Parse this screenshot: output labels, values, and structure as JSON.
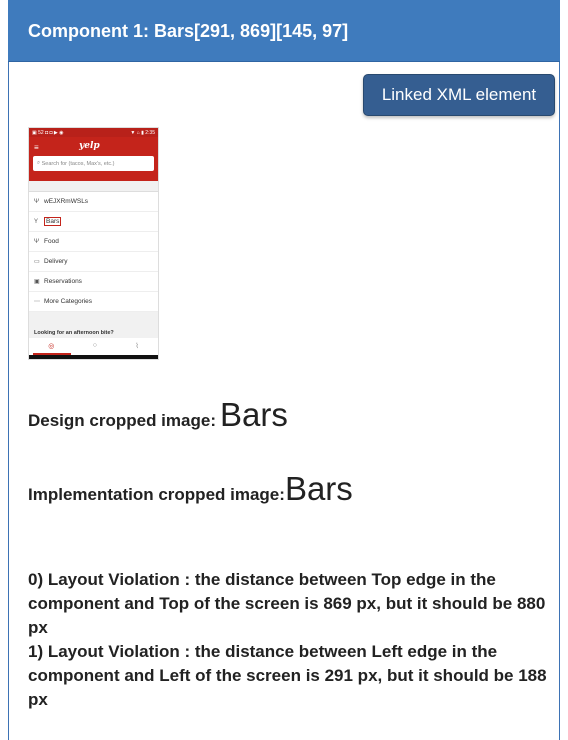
{
  "header": {
    "title": "Component 1: Bars[291, 869][145, 97]"
  },
  "button": {
    "label": "Linked XML element"
  },
  "phone": {
    "status_left": "▣ 52 ◘ ◘ ▶ ◉",
    "status_right": "▼ ⌂ ▮ 2:35",
    "logo": "yelp",
    "search_placeholder": "Search for (tacos, Max's, etc.)",
    "rows": [
      {
        "label": "wEJXRmWSLs",
        "icon": "fork-knife-icon"
      },
      {
        "label": "Bars",
        "icon": "cocktail-icon"
      },
      {
        "label": "Food",
        "icon": "fork-knife-icon"
      },
      {
        "label": "Delivery",
        "icon": "truck-icon"
      },
      {
        "label": "Reservations",
        "icon": "calendar-icon"
      },
      {
        "label": "More Categories",
        "icon": "dots-icon"
      }
    ],
    "section_title": "Looking for an afternoon bite?"
  },
  "design": {
    "label": "Design cropped image:",
    "crop_text": "Bars"
  },
  "implementation": {
    "label": "Implementation cropped image:",
    "crop_text": "Bars"
  },
  "violations": [
    "0) Layout Violation : the distance between Top edge in the component and Top of the screen is 869 px, but it should be 880 px",
    "1) Layout Violation : the distance between Left edge in the component and Left of the screen is 291 px, but it should be 188 px"
  ]
}
